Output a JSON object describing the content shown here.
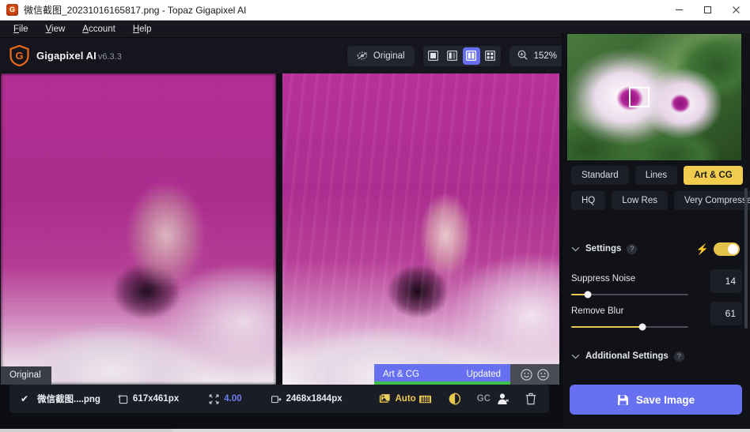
{
  "window": {
    "title": "微信截图_20231016165817.png - Topaz Gigapixel AI",
    "app_icon": "topaz-shield-icon",
    "minimize": "−",
    "maximize": "□",
    "close": "×"
  },
  "menubar": {
    "items": [
      {
        "label": "File",
        "mnemonic": "F"
      },
      {
        "label": "View",
        "mnemonic": "V"
      },
      {
        "label": "Account",
        "mnemonic": "A"
      },
      {
        "label": "Help",
        "mnemonic": "H"
      }
    ]
  },
  "toolbar": {
    "brand_name": "Gigapixel AI",
    "brand_version": "v6.3.3",
    "compare_label": "Original",
    "compare_icon": "eye-off-icon",
    "view_modes": [
      {
        "name": "single-view",
        "icon": "single-pane-icon",
        "active": false
      },
      {
        "name": "split-view",
        "icon": "split-pane-icon",
        "active": false
      },
      {
        "name": "side-by-side-view",
        "icon": "side-by-side-icon",
        "active": true
      },
      {
        "name": "grid-view",
        "icon": "grid-pane-icon",
        "active": false
      }
    ],
    "zoom_icon": "magnifier-plus-icon",
    "zoom_level": "152%",
    "zoom_caret": "▾"
  },
  "viewers": {
    "left": {
      "badge": "Original"
    },
    "right": {
      "model_label": "Art & CG",
      "status": "Updated",
      "faces": [
        {
          "name": "smiley-face-icon",
          "glyph": "☺"
        },
        {
          "name": "neutral-face-icon",
          "glyph": "😐"
        }
      ]
    }
  },
  "panel": {
    "thumbnail": {
      "name": "navigator-thumbnail",
      "selection_box": "viewport-indicator"
    },
    "models_row1": [
      {
        "label": "Standard",
        "active": false
      },
      {
        "label": "Lines",
        "active": false
      },
      {
        "label": "Art & CG",
        "active": true
      }
    ],
    "models_row2": [
      {
        "label": "HQ",
        "active": false
      },
      {
        "label": "Low Res",
        "active": false
      },
      {
        "label": "Very Compressed",
        "active": false
      }
    ],
    "settings": {
      "title": "Settings",
      "help": "?",
      "caret": "⌄",
      "auto_icon": "lightning-bolt-icon",
      "toggle_on": true
    },
    "sliders": [
      {
        "label": "Suppress Noise",
        "value": "14",
        "percent": 14
      },
      {
        "label": "Remove Blur",
        "value": "61",
        "percent": 61
      }
    ],
    "additional": {
      "title": "Additional Settings",
      "help": "?",
      "caret": "⌄"
    }
  },
  "filebar": {
    "check": "✔",
    "filename": "微信截图....png",
    "source_icon": "image-size-icon",
    "source_size": "617x461px",
    "scale_icon": "resize-arrows-icon",
    "scale": "4.00",
    "output_icon": "export-size-icon",
    "output_size": "2468x1844px",
    "auto_icon": "stacked-photos-icon",
    "auto_label": "Auto",
    "tools": [
      {
        "name": "crop-icon"
      },
      {
        "name": "face-recovery-icon"
      },
      {
        "name": "gc-label",
        "label": "GC"
      },
      {
        "name": "person-icon"
      },
      {
        "name": "trash-icon"
      }
    ]
  },
  "save": {
    "label": "Save Image",
    "icon": "floppy-disk-icon"
  },
  "colors": {
    "accent_blue": "#6670f0",
    "accent_yellow": "#f2cc4f",
    "status_green": "#3cc04a",
    "panel_bg": "#111218",
    "app_bg": "#0d0e14",
    "toolbar_bg": "#15161d"
  }
}
